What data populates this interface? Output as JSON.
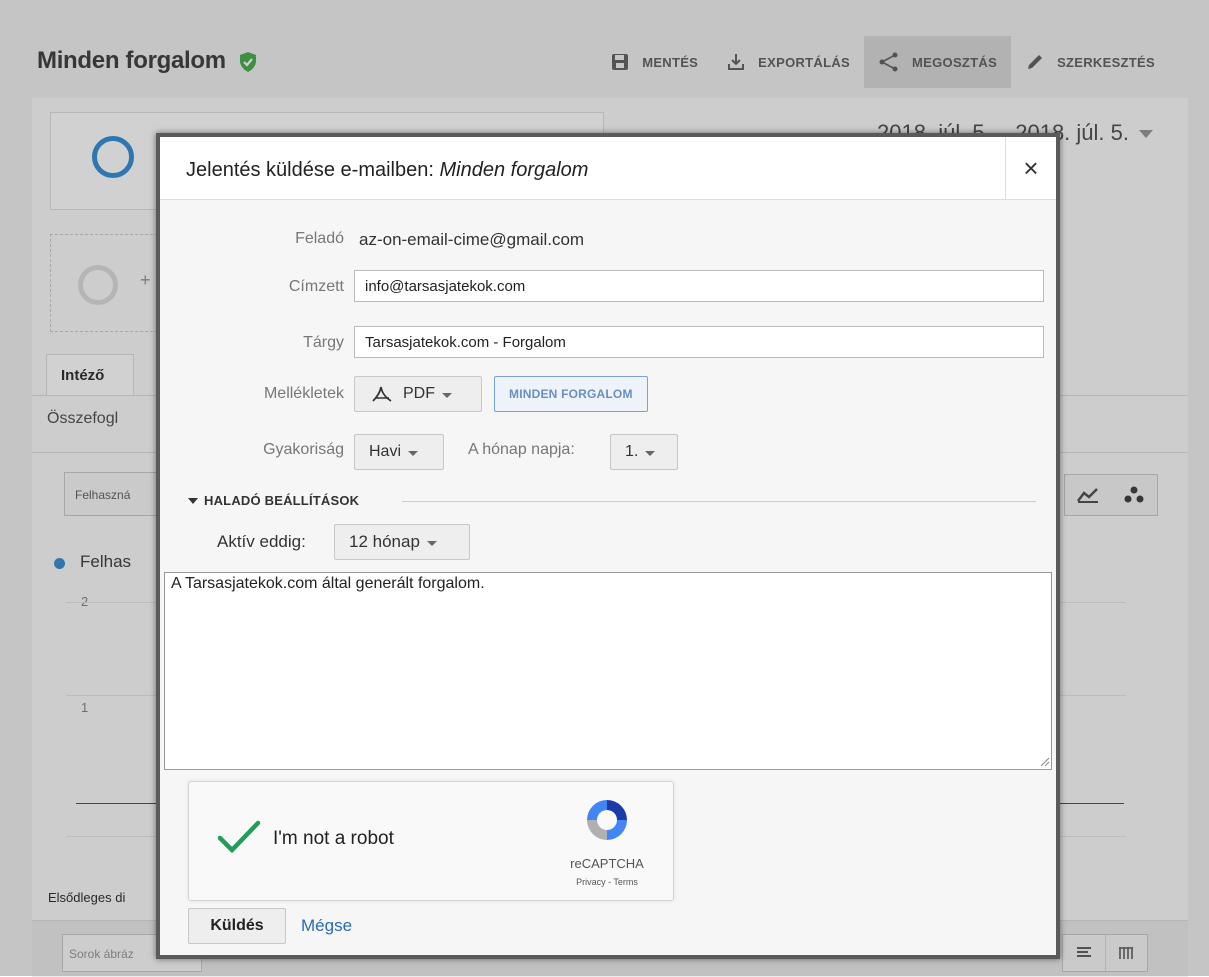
{
  "page": {
    "title": "Minden forgalom",
    "toolbar": {
      "save": "MENTÉS",
      "export": "EXPORTÁLÁS",
      "share": "MEGOSZTÁS",
      "edit": "SZERKESZTÉS"
    },
    "date_range": "2018. júl. 5. – 2018. júl. 5.",
    "segment_add_symbol": "+",
    "tab_active": "Intéző",
    "subtab": "Összefogl",
    "metric_select": "Felhaszná",
    "legend_label": "Felhas",
    "axis_labels": [
      "2",
      "1"
    ],
    "primary_dimension_label": "Elsődleges di",
    "rows_placeholder": "Sorok ábráz"
  },
  "dialog": {
    "title_prefix": "Jelentés küldése e-mailben: ",
    "title_report": "Minden forgalom",
    "close_symbol": "×",
    "from": {
      "label": "Feladó",
      "value": "az-on-email-cime@gmail.com"
    },
    "to": {
      "label": "Címzett",
      "value": "info@tarsasjatekok.com"
    },
    "subject": {
      "label": "Tárgy",
      "value": "Tarsasjatekok.com - Forgalom"
    },
    "attachments": {
      "label": "Mellékletek",
      "format": "PDF",
      "report_chip": "MINDEN FORGALOM"
    },
    "frequency": {
      "label": "Gyakoriság",
      "value": "Havi",
      "day_label": "A hónap napja:",
      "day_value": "1."
    },
    "advanced": {
      "label": "HALADÓ BEÁLLÍTÁSOK",
      "active_until_label": "Aktív eddig:",
      "active_until_value": "12 hónap"
    },
    "message": "A Tarsasjatekok.com által generált forgalom.",
    "captcha": {
      "text": "I'm not a robot",
      "brand": "reCAPTCHA",
      "links": "Privacy - Terms"
    },
    "send_label": "Küldés",
    "cancel_label": "Mégse"
  },
  "colors": {
    "accent_blue": "#3b91d8",
    "link_blue": "#2a6bb5",
    "check_green": "#1e9e5a",
    "shield_green": "#4caf50"
  }
}
